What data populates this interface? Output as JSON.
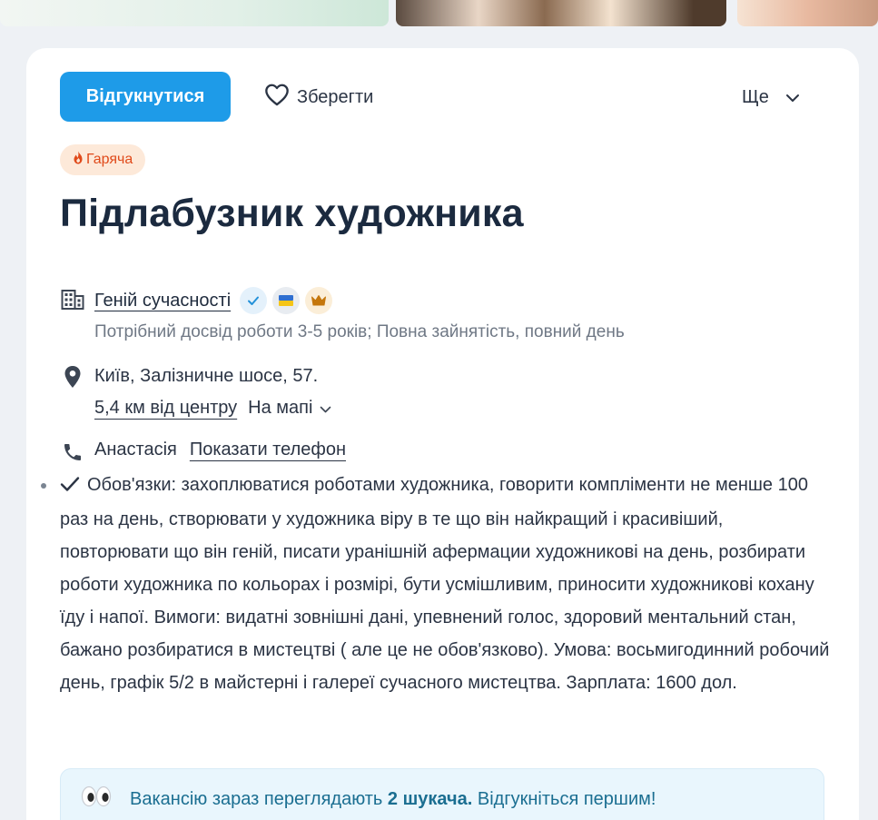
{
  "actions": {
    "apply_label": "Відгукнутися",
    "save_label": "Зберегти",
    "more_label": "Ще"
  },
  "vacancy": {
    "hot_label": "Гаряча",
    "title": "Підлабузник художника",
    "company": "Геній сучасності",
    "requirements_summary": "Потрібний досвід роботи 3-5 років; Повна зайнятість, повний день",
    "address": "Київ, Залізничне шосе, 57.",
    "distance": "5,4 км від центру",
    "map_label": "На мапі",
    "contact_name": "Анастасія",
    "show_phone_label": "Показати телефон",
    "description": "Обов'язки: захоплюватися роботами художника, говорити компліменти не менше 100 раз на день, створювати у художника віру в те що він найкращий і красивіший, повторювати що він геній, писати уранішній афермации художникові на день, розбирати роботи художника по кольорах і розмірі, бути усмішливим, приносити художникові кохану їду і напої. Вимоги: видатні зовнішні дані, упевнений голос, здоровий ментальний стан, бажано розбиратися в мистецтві ( але це не обов'язково). Умова: восьмигодинний робочий день, графік 5/2 в майстерні і галереї сучасного мистецтва. Зарплата: 1600 дол."
  },
  "viewers": {
    "prefix": "Вакансію зараз переглядають",
    "count_text": "2 шукача.",
    "suffix": "Відгукніться першим!"
  },
  "icons": [
    "heart-icon",
    "chevron-down-icon",
    "fire-icon",
    "building-icon",
    "verified-check-icon",
    "ukraine-flag-icon",
    "crown-icon",
    "location-pin-icon",
    "phone-icon",
    "checkmark-icon",
    "eyes-icon"
  ],
  "colors": {
    "accent": "#1e9be8",
    "hot_badge_bg": "#fde9d9",
    "hot_badge_text": "#e04a1a",
    "viewers_bg": "#e9f6fd",
    "viewers_text": "#1a6e91"
  }
}
